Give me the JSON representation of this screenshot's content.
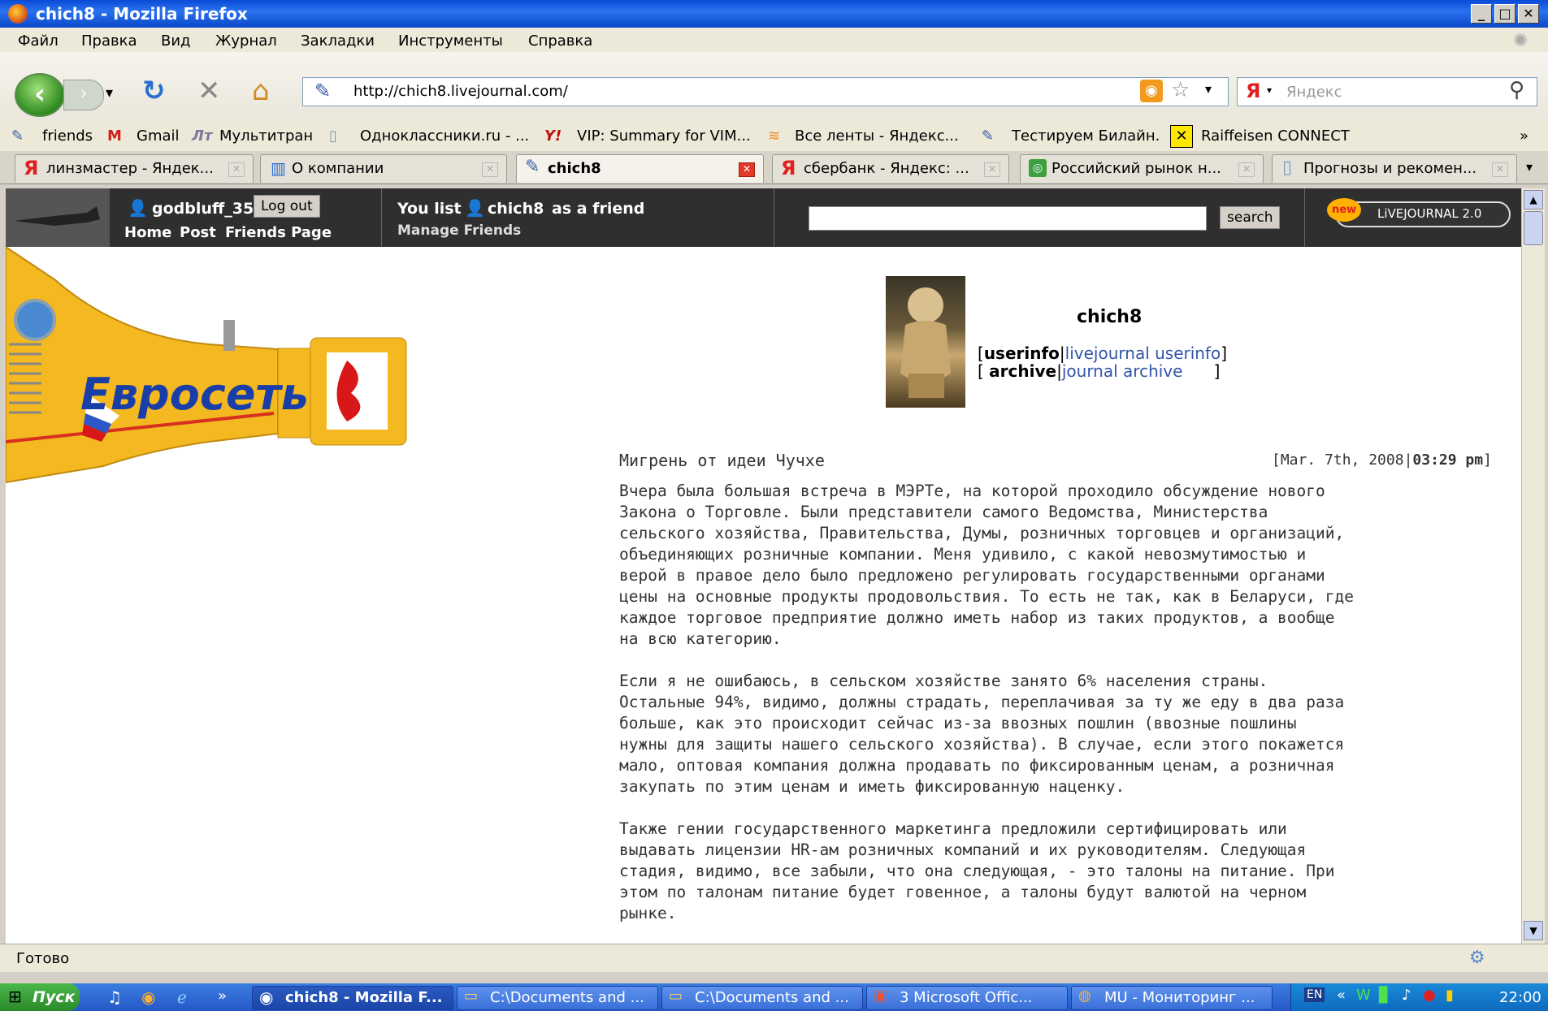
{
  "window": {
    "title": "chich8 - Mozilla Firefox"
  },
  "menu": [
    "Файл",
    "Правка",
    "Вид",
    "Журнал",
    "Закладки",
    "Инструменты",
    "Справка"
  ],
  "nav": {
    "url": "http://chich8.livejournal.com/",
    "search_placeholder": "Яндекс",
    "search_engine": "Я"
  },
  "bookmarks": [
    "friends",
    "Gmail",
    "Мультитран",
    "Одноклассники.ru - ...",
    "VIP: Summary for VIM...",
    "Все ленты - Яндекс...",
    "Тестируем Билайн.",
    "Raiffeisen CONNECT",
    "»"
  ],
  "tabs": [
    {
      "label": "линзмастер - Яндек...",
      "active": false
    },
    {
      "label": "О компании",
      "active": false
    },
    {
      "label": "chich8",
      "active": true
    },
    {
      "label": "сбербанк - Яндекс: ...",
      "active": false
    },
    {
      "label": "Российский рынок н...",
      "active": false
    },
    {
      "label": "Прогнозы и рекомен...",
      "active": false
    }
  ],
  "lj": {
    "username": "godbluff_35",
    "logout": "Log out",
    "links": [
      "Home",
      "Post",
      "Friends Page"
    ],
    "friend_prefix": "You list",
    "friend_user": "chich8",
    "friend_suffix": "as a friend",
    "manage": "Manage Friends",
    "search_button": "search",
    "new_badge": "new",
    "lj_badge": "LiVEJOURNAL 2.0"
  },
  "banner": {
    "text": "Евросеть"
  },
  "profile": {
    "name": "chich8",
    "userinfo_bold": "userinfo",
    "userinfo_link": "livejournal userinfo",
    "archive_bold": "archive",
    "archive_link": "journal archive"
  },
  "post": {
    "title": "Мигрень от идеи Чучхе",
    "date": "Mar. 7th, 2008",
    "time": "03:29 pm",
    "paragraphs": [
      [
        "Вчера была большая встреча в МЭРТе, на которой проходило обсуждение нового",
        "Закона о Торговле. Были представители самого Ведомства, Министерства",
        "сельского хозяйства, Правительства, Думы, розничных торговцев и организаций,",
        "объединяющих розничные компании. Меня удивило, с какой невозмутимостью и",
        "верой в правое дело было предложено регулировать государственными органами",
        "цены на основные продукты продовольствия. То есть не так, как в Беларуси, где",
        "каждое торговое предприятие должно иметь набор из таких продуктов, а вообще",
        "на всю категорию."
      ],
      [
        "Если я не ошибаюсь, в сельском хозяйстве занято 6% населения страны.",
        "Остальные 94%, видимо, должны страдать, переплачивая за ту же еду в два раза",
        "больше, как это происходит сейчас из-за ввозных пошлин (ввозные пошлины",
        "нужны для защиты нашего сельского хозяйства). В случае, если этого покажется",
        "мало, оптовая компания должна продавать по фиксированным ценам, а розничная",
        "закупать по этим ценам и иметь фиксированную наценку."
      ],
      [
        "Также гении государственного маркетинга предложили сертифицировать или",
        "выдавать лицензии HR-ам розничных компаний и их руководителям. Следующая",
        "стадия, видимо, все забыли, что она следующая, - это талоны на питание. При",
        "этом по талонам питание будет говенное, а талоны будут валютой на черном",
        "рынке."
      ]
    ]
  },
  "status": {
    "text": "Готово"
  },
  "taskbar": {
    "start": "Пуск",
    "buttons": [
      "chich8 - Mozilla F...",
      "C:\\Documents and ...",
      "C:\\Documents and ...",
      "3 Microsoft Offic...",
      "MU - Мониторинг ..."
    ],
    "lang": "EN",
    "clock": "22:00"
  }
}
